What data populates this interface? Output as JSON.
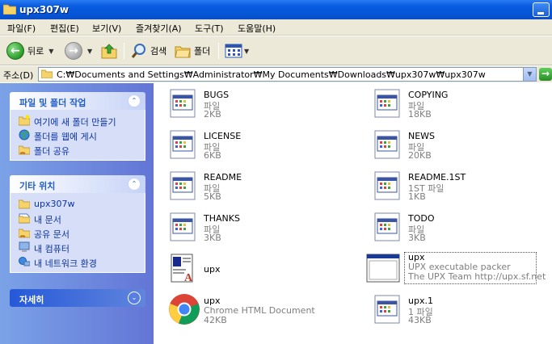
{
  "window": {
    "title": "upx307w"
  },
  "menu": [
    "파일(F)",
    "편집(E)",
    "보기(V)",
    "즐겨찾기(A)",
    "도구(T)",
    "도움말(H)"
  ],
  "toolbar": {
    "back_label": "뒤로",
    "search_label": "검색",
    "folders_label": "폴더"
  },
  "address": {
    "label": "주소(D)",
    "path": "C:₩Documents and Settings₩Administrator₩My Documents₩Downloads₩upx307w₩upx307w"
  },
  "left_pane": {
    "tasks": {
      "title": "파일 및 폴더 작업",
      "items": [
        "여기에 새 폴더 만들기",
        "폴더를 웹에 게시",
        "폴더 공유"
      ]
    },
    "other_places": {
      "title": "기타 위치",
      "items": [
        "upx307w",
        "내 문서",
        "공유 문서",
        "내 컴퓨터",
        "내 네트워크 환경"
      ]
    },
    "details": {
      "title": "자세히"
    }
  },
  "files": [
    {
      "name": "BUGS",
      "type": "파일",
      "size": "2KB",
      "icon": "generic-file-icon"
    },
    {
      "name": "COPYING",
      "type": "파일",
      "size": "18KB",
      "icon": "generic-file-icon"
    },
    {
      "name": "LICENSE",
      "type": "파일",
      "size": "6KB",
      "icon": "generic-file-icon"
    },
    {
      "name": "NEWS",
      "type": "파일",
      "size": "20KB",
      "icon": "generic-file-icon"
    },
    {
      "name": "README",
      "type": "파일",
      "size": "5KB",
      "icon": "generic-file-icon"
    },
    {
      "name": "README.1ST",
      "type": "1ST 파일",
      "size": "1KB",
      "icon": "generic-file-icon"
    },
    {
      "name": "THANKS",
      "type": "파일",
      "size": "3KB",
      "icon": "generic-file-icon"
    },
    {
      "name": "TODO",
      "type": "파일",
      "size": "3KB",
      "icon": "generic-file-icon"
    },
    {
      "name": "upx",
      "type": "",
      "size": "",
      "icon": "document-icon"
    },
    {
      "name": "upx",
      "type": "UPX executable packer",
      "size": "The UPX Team http://upx.sf.net",
      "icon": "executable-icon"
    },
    {
      "name": "upx",
      "type": "Chrome HTML Document",
      "size": "42KB",
      "icon": "chrome-icon"
    },
    {
      "name": "upx.1",
      "type": "1 파일",
      "size": "43KB",
      "icon": "generic-file-icon"
    }
  ]
}
